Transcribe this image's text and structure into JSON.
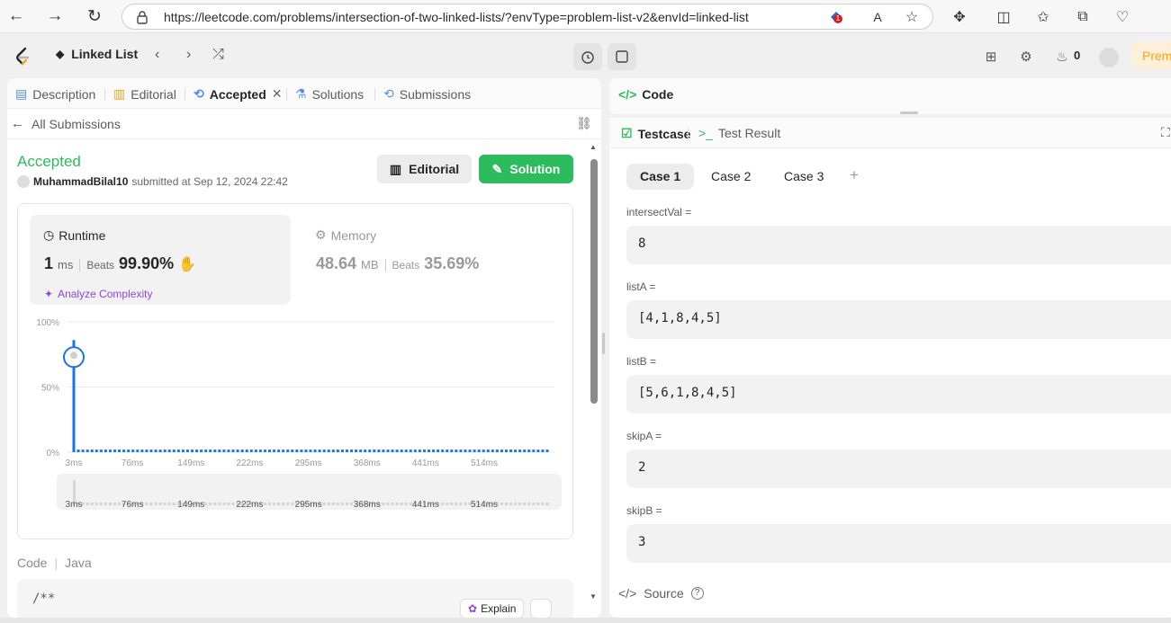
{
  "browser": {
    "url": "https://leetcode.com/problems/intersection-of-two-linked-lists/?envType=problem-list-v2&envId=linked-list",
    "extension_badge": "1"
  },
  "lc_nav": {
    "list_title": "Linked List",
    "streak_count": "0",
    "premium_label": "Prem"
  },
  "left_tabs": {
    "description": "Description",
    "editorial": "Editorial",
    "accepted": "Accepted",
    "solutions": "Solutions",
    "submissions": "Submissions"
  },
  "back": {
    "label": "All Submissions"
  },
  "submission": {
    "status": "Accepted",
    "user": "MuhammadBilal10",
    "submitted_text": "submitted at Sep 12, 2024 22:42",
    "editorial_btn": "Editorial",
    "solution_btn": "Solution"
  },
  "runtime": {
    "label": "Runtime",
    "value": "1",
    "unit": "ms",
    "beats_label": "Beats",
    "beats": "99.90%",
    "analyze": "Analyze Complexity"
  },
  "memory": {
    "label": "Memory",
    "value": "48.64",
    "unit": "MB",
    "beats_label": "Beats",
    "beats": "35.69%"
  },
  "chart_data": {
    "type": "bar",
    "categories": [
      "3ms",
      "76ms",
      "149ms",
      "222ms",
      "295ms",
      "368ms",
      "441ms",
      "514ms"
    ],
    "y_ticks": [
      "100%",
      "50%",
      "0%"
    ],
    "ylim": [
      0,
      100
    ],
    "highlight_bar_value": 86,
    "other_bar_value": 2,
    "minimap_labels": [
      "3ms",
      "76ms",
      "149ms",
      "222ms",
      "295ms",
      "368ms",
      "441ms",
      "514ms"
    ],
    "colors": {
      "bar": "#1a73e8",
      "grid": "#e8e8e8"
    }
  },
  "code_section": {
    "label": "Code",
    "language": "Java",
    "first_line": "/**",
    "explain_btn": "Explain"
  },
  "right": {
    "code_title": "Code",
    "testcase_tab": "Testcase",
    "result_tab": "Test Result",
    "cases": [
      "Case 1",
      "Case 2",
      "Case 3"
    ],
    "add_case": "+",
    "vars": [
      {
        "label": "intersectVal =",
        "value": "8"
      },
      {
        "label": "listA =",
        "value": "[4,1,8,4,5]"
      },
      {
        "label": "listB =",
        "value": "[5,6,1,8,4,5]"
      },
      {
        "label": "skipA =",
        "value": "2"
      },
      {
        "label": "skipB =",
        "value": "3"
      }
    ],
    "source_label": "Source"
  }
}
